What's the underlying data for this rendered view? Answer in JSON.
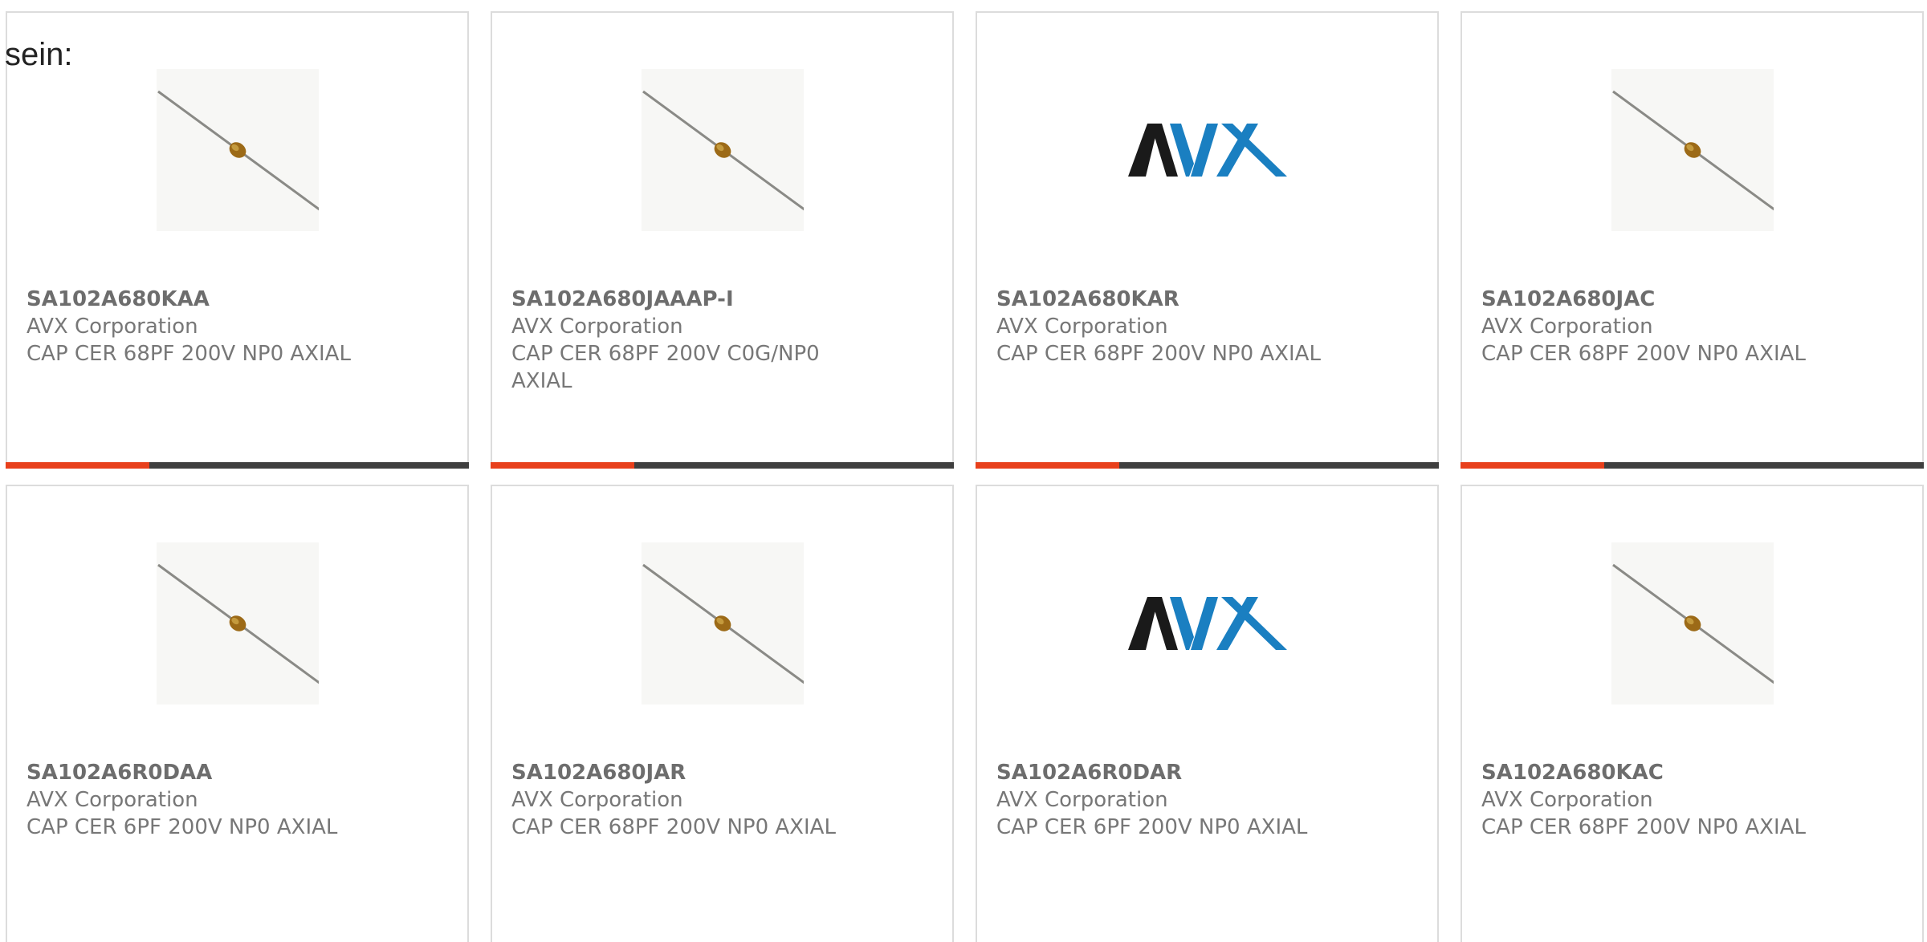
{
  "page": {
    "heading": "sein:"
  },
  "colors": {
    "accent": "#e8401c",
    "bar": "#3f3f3f",
    "avx_black": "#1a1a1a",
    "avx_blue": "#1a7fc1"
  },
  "products": [
    {
      "part_number": "SA102A680KAA",
      "manufacturer": "AVX Corporation",
      "description": "CAP CER 68PF 200V NP0 AXIAL",
      "image": "axial-capacitor",
      "bar_progress": 0.31
    },
    {
      "part_number": "SA102A680JAAAP-I",
      "manufacturer": "AVX Corporation",
      "description": "CAP CER 68PF 200V C0G/NP0 AXIAL",
      "image": "axial-capacitor",
      "bar_progress": 0.31
    },
    {
      "part_number": "SA102A680KAR",
      "manufacturer": "AVX Corporation",
      "description": "CAP CER 68PF 200V NP0 AXIAL",
      "image": "avx-logo",
      "logo_text": "AVX",
      "bar_progress": 0.31
    },
    {
      "part_number": "SA102A680JAC",
      "manufacturer": "AVX Corporation",
      "description": "CAP CER 68PF 200V NP0 AXIAL",
      "image": "axial-capacitor",
      "bar_progress": 0.31
    },
    {
      "part_number": "SA102A6R0DAA",
      "manufacturer": "AVX Corporation",
      "description": "CAP CER 6PF 200V NP0 AXIAL",
      "image": "axial-capacitor"
    },
    {
      "part_number": "SA102A680JAR",
      "manufacturer": "AVX Corporation",
      "description": "CAP CER 68PF 200V NP0 AXIAL",
      "image": "axial-capacitor"
    },
    {
      "part_number": "SA102A6R0DAR",
      "manufacturer": "AVX Corporation",
      "description": "CAP CER 6PF 200V NP0 AXIAL",
      "image": "avx-logo",
      "logo_text": "AVX"
    },
    {
      "part_number": "SA102A680KAC",
      "manufacturer": "AVX Corporation",
      "description": "CAP CER 68PF 200V NP0 AXIAL",
      "image": "axial-capacitor"
    }
  ]
}
